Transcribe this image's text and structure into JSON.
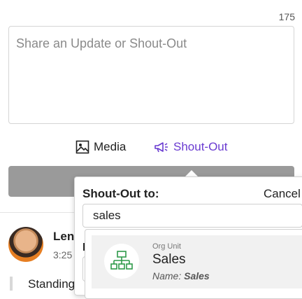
{
  "composer": {
    "char_count": "175",
    "placeholder": "Share an Update or Shout-Out",
    "media_label": "Media",
    "shoutout_label": "Shout-Out",
    "accent_color": "#6a3bd1"
  },
  "post": {
    "author": "Len",
    "time": "3:25",
    "text": "Standing"
  },
  "shoutout_popup": {
    "title": "Shout-Out to:",
    "cancel_label": "Cancel",
    "search_value": "sales",
    "hidden_label": "I"
  },
  "results": [
    {
      "type": "Org Unit",
      "name": "Sales",
      "sub_prefix": "Name:",
      "sub_value": "Sales",
      "icon": "org-chart-icon",
      "icon_color": "#2e9a4a"
    }
  ]
}
